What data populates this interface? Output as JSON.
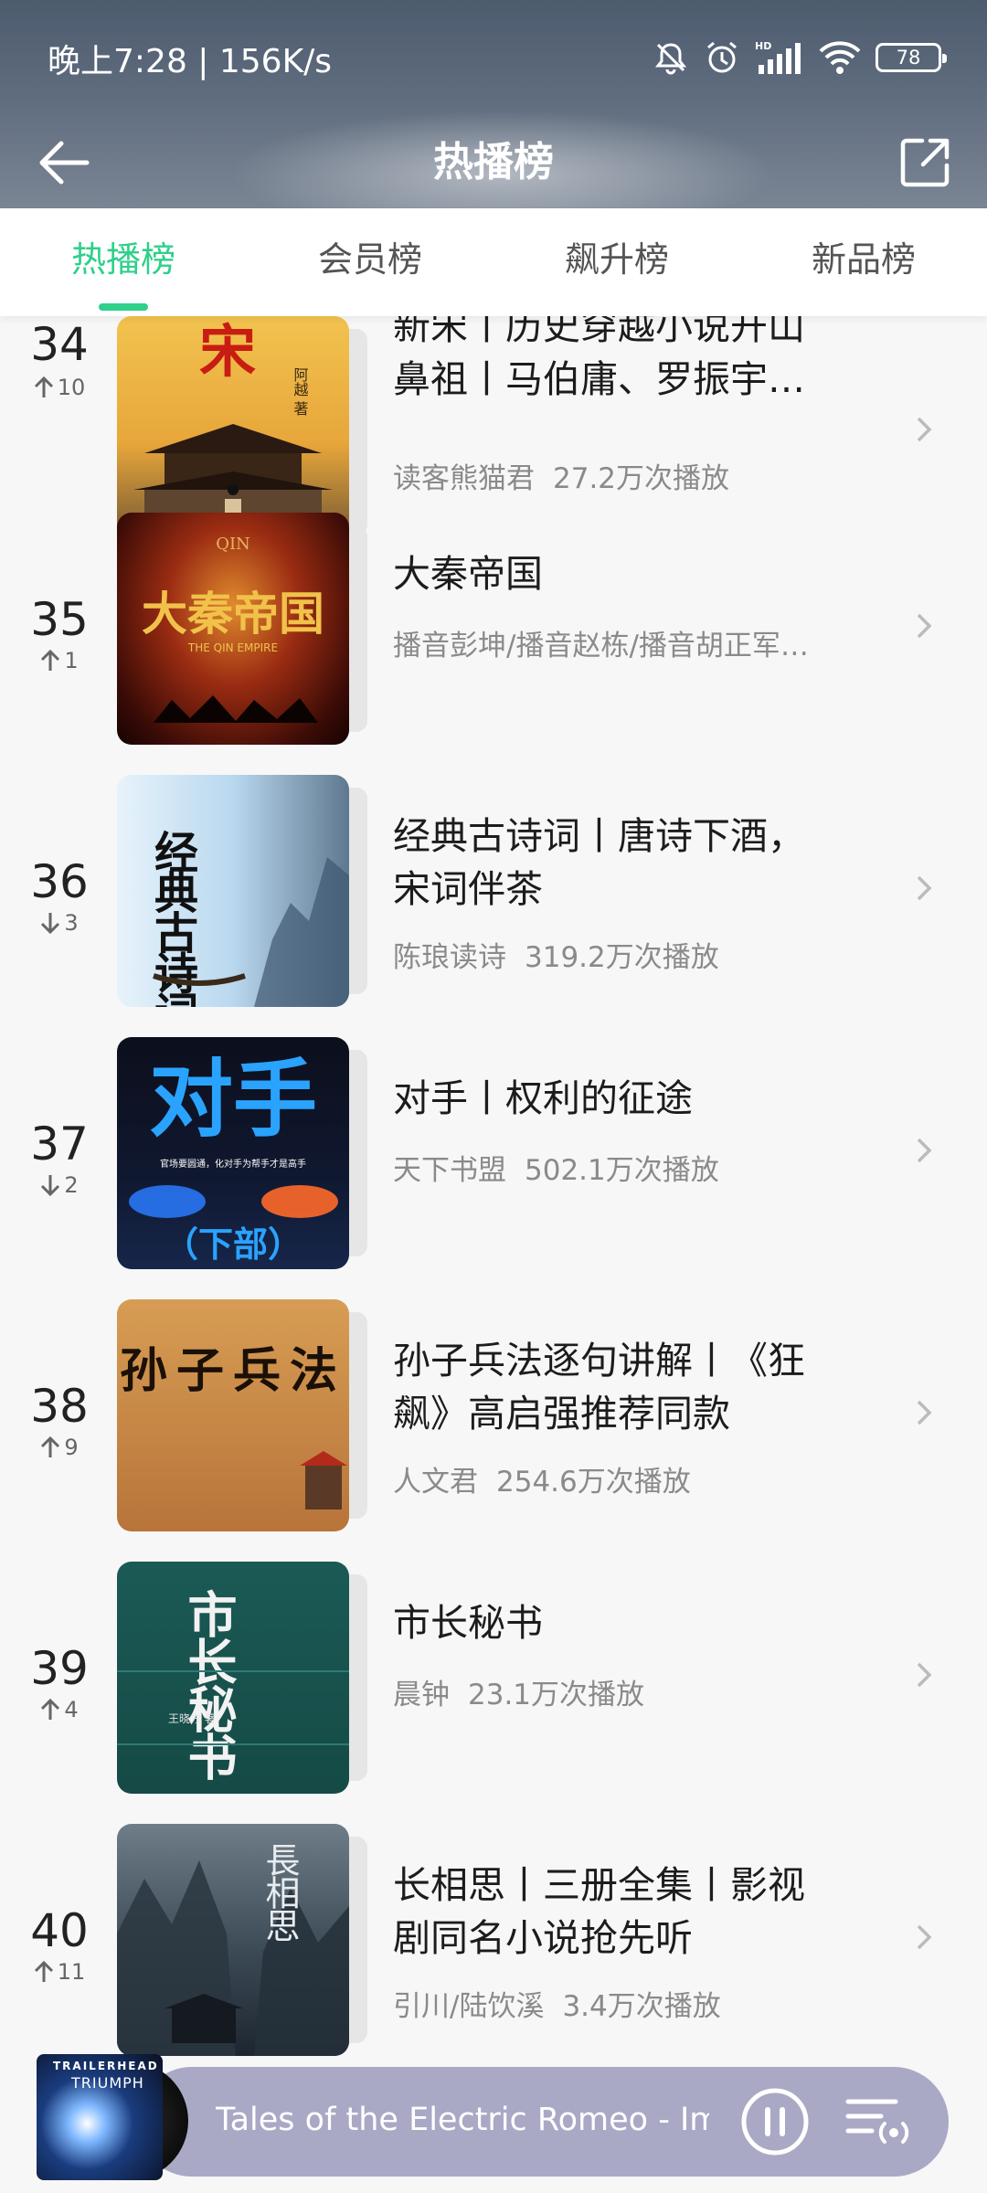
{
  "status_bar": {
    "time": "晚上7:28 | 156K/s",
    "battery": "78",
    "icons": [
      "mute-icon",
      "alarm-icon",
      "hd-signal-icon",
      "wifi-icon",
      "battery-icon"
    ]
  },
  "nav": {
    "title": "热播榜",
    "back_icon": "back-arrow-icon",
    "share_icon": "share-icon"
  },
  "tabs": [
    {
      "label": "热播榜",
      "active": true
    },
    {
      "label": "会员榜",
      "active": false
    },
    {
      "label": "飙升榜",
      "active": false
    },
    {
      "label": "新品榜",
      "active": false
    }
  ],
  "colors": {
    "accent": "#2fd08a",
    "header": "#5a6779",
    "player": "#a9a9c6"
  },
  "items": [
    {
      "rank": "34",
      "trend": "up",
      "change": "10",
      "title_lines": [
        "新宋丨历史穿越小说开山",
        "鼻祖丨马伯庸、罗振宇…"
      ],
      "author": "读客熊猫君",
      "plays": "27.2万次播放",
      "cover_text": "宋",
      "cover_sub": "阿越 著"
    },
    {
      "rank": "35",
      "trend": "up",
      "change": "1",
      "title_lines": [
        "大秦帝国"
      ],
      "author": "播音彭坤/播音赵栋/播音胡正军…",
      "plays": "",
      "cover_text": "大秦帝国",
      "cover_sub": "THE QIN EMPIRE",
      "cover_top": "QIN"
    },
    {
      "rank": "36",
      "trend": "down",
      "change": "3",
      "title_lines": [
        "经典古诗词丨唐诗下酒，",
        "宋词伴茶"
      ],
      "author": "陈琅读诗",
      "plays": "319.2万次播放",
      "cover_text": "经典古诗词"
    },
    {
      "rank": "37",
      "trend": "down",
      "change": "2",
      "title_lines": [
        "对手丨权利的征途"
      ],
      "author": "天下书盟",
      "plays": "502.1万次播放",
      "cover_text": "对手",
      "cover_sub": "官场要圆通，化对手为帮手才是高手",
      "cover_bottom": "（下部）"
    },
    {
      "rank": "38",
      "trend": "up",
      "change": "9",
      "title_lines": [
        "孙子兵法逐句讲解丨《狂",
        "飙》高启强推荐同款"
      ],
      "author": "人文君",
      "plays": "254.6万次播放",
      "cover_text": "孙子兵法"
    },
    {
      "rank": "39",
      "trend": "up",
      "change": "4",
      "title_lines": [
        "市长秘书"
      ],
      "author": "晨钟",
      "plays": "23.1万次播放",
      "cover_text": "市长秘书",
      "cover_sub": "王晓方 著"
    },
    {
      "rank": "40",
      "trend": "up",
      "change": "11",
      "title_lines": [
        "长相思丨三册全集丨影视",
        "剧同名小说抢先听"
      ],
      "author": "引川/陆饮溪",
      "plays": "3.4万次播放",
      "cover_text": "長相思"
    }
  ],
  "player": {
    "song": "Tales of the Electric Romeo - Imr",
    "art_label_top": "TRAILERHEAD",
    "art_label_main": "TRIUMPH",
    "pause_icon": "pause-icon",
    "queue_icon": "playlist-icon"
  }
}
